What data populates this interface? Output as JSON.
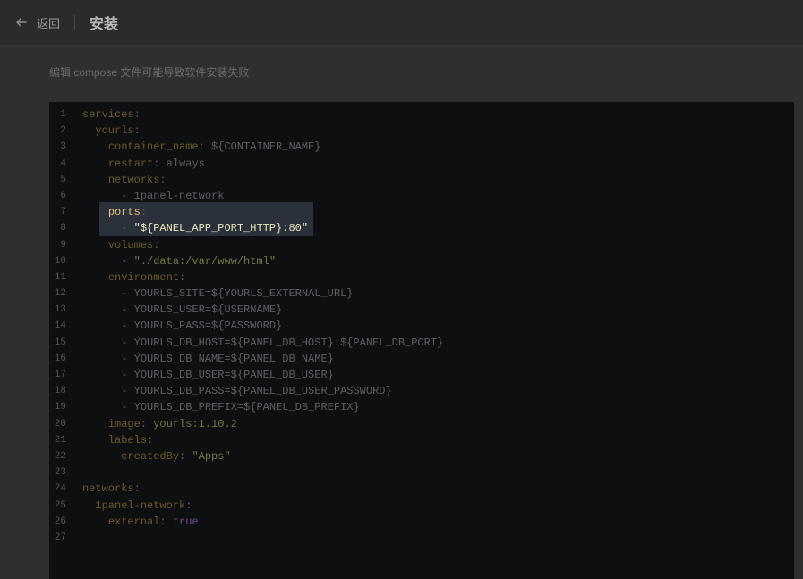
{
  "header": {
    "back_label": "返回",
    "title": "安装"
  },
  "warning_text": "编辑 compose 文件可能导致软件安装失败",
  "editor": {
    "highlighted_lines": [
      7,
      8
    ],
    "lines": [
      {
        "num": "1",
        "indent": "",
        "key": "services",
        "sep": ":",
        "value": "",
        "vtype": ""
      },
      {
        "num": "2",
        "indent": "  ",
        "key": "yourls",
        "sep": ":",
        "value": "",
        "vtype": ""
      },
      {
        "num": "3",
        "indent": "    ",
        "key": "container_name",
        "sep": ": ",
        "value": "${CONTAINER_NAME}",
        "vtype": "v"
      },
      {
        "num": "4",
        "indent": "    ",
        "key": "restart",
        "sep": ": ",
        "value": "always",
        "vtype": "v"
      },
      {
        "num": "5",
        "indent": "    ",
        "key": "networks",
        "sep": ":",
        "value": "",
        "vtype": ""
      },
      {
        "num": "6",
        "indent": "      ",
        "key": "",
        "sep": "- ",
        "value": "1panel-network",
        "vtype": "v"
      },
      {
        "num": "7",
        "indent": "    ",
        "key": "ports",
        "sep": ":",
        "value": "",
        "vtype": ""
      },
      {
        "num": "8",
        "indent": "      ",
        "key": "",
        "sep": "- ",
        "value": "\"${PANEL_APP_PORT_HTTP}:80\"",
        "vtype": "s"
      },
      {
        "num": "9",
        "indent": "    ",
        "key": "volumes",
        "sep": ":",
        "value": "",
        "vtype": ""
      },
      {
        "num": "10",
        "indent": "      ",
        "key": "",
        "sep": "- ",
        "value": "\"./data:/var/www/html\"",
        "vtype": "s"
      },
      {
        "num": "11",
        "indent": "    ",
        "key": "environment",
        "sep": ":",
        "value": "",
        "vtype": ""
      },
      {
        "num": "12",
        "indent": "      ",
        "key": "",
        "sep": "- ",
        "value": "YOURLS_SITE=${YOURLS_EXTERNAL_URL}",
        "vtype": "v"
      },
      {
        "num": "13",
        "indent": "      ",
        "key": "",
        "sep": "- ",
        "value": "YOURLS_USER=${USERNAME}",
        "vtype": "v"
      },
      {
        "num": "14",
        "indent": "      ",
        "key": "",
        "sep": "- ",
        "value": "YOURLS_PASS=${PASSWORD}",
        "vtype": "v"
      },
      {
        "num": "15",
        "indent": "      ",
        "key": "",
        "sep": "- ",
        "value": "YOURLS_DB_HOST=${PANEL_DB_HOST}:${PANEL_DB_PORT}",
        "vtype": "v"
      },
      {
        "num": "16",
        "indent": "      ",
        "key": "",
        "sep": "- ",
        "value": "YOURLS_DB_NAME=${PANEL_DB_NAME}",
        "vtype": "v"
      },
      {
        "num": "17",
        "indent": "      ",
        "key": "",
        "sep": "- ",
        "value": "YOURLS_DB_USER=${PANEL_DB_USER}",
        "vtype": "v"
      },
      {
        "num": "18",
        "indent": "      ",
        "key": "",
        "sep": "- ",
        "value": "YOURLS_DB_PASS=${PANEL_DB_USER_PASSWORD}",
        "vtype": "v"
      },
      {
        "num": "19",
        "indent": "      ",
        "key": "",
        "sep": "- ",
        "value": "YOURLS_DB_PREFIX=${PANEL_DB_PREFIX}",
        "vtype": "v"
      },
      {
        "num": "20",
        "indent": "    ",
        "key": "image",
        "sep": ": ",
        "value": "yourls:1.10.2",
        "vtype": "s"
      },
      {
        "num": "21",
        "indent": "    ",
        "key": "labels",
        "sep": ":",
        "value": "",
        "vtype": ""
      },
      {
        "num": "22",
        "indent": "      ",
        "key": "createdBy",
        "sep": ": ",
        "value": "\"Apps\"",
        "vtype": "s"
      },
      {
        "num": "23",
        "indent": "",
        "key": "",
        "sep": "",
        "value": "",
        "vtype": ""
      },
      {
        "num": "24",
        "indent": "",
        "key": "networks",
        "sep": ":",
        "value": "",
        "vtype": ""
      },
      {
        "num": "25",
        "indent": "  ",
        "key": "1panel-network",
        "sep": ":",
        "value": "",
        "vtype": ""
      },
      {
        "num": "26",
        "indent": "    ",
        "key": "external",
        "sep": ": ",
        "value": "true",
        "vtype": "kw"
      },
      {
        "num": "27",
        "indent": "",
        "key": "",
        "sep": "",
        "value": "",
        "vtype": ""
      }
    ]
  }
}
